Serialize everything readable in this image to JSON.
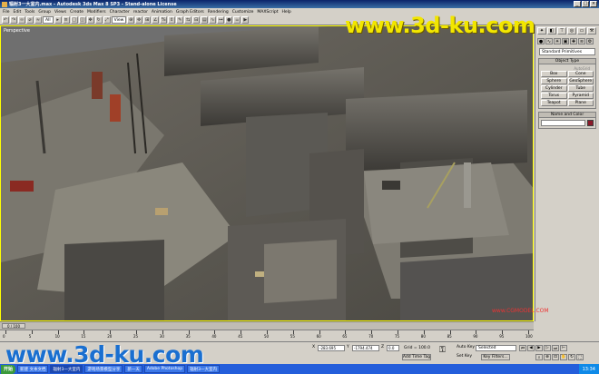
{
  "window": {
    "title": "辐射3一大室内.max - Autodesk 3ds Max 8 SP3 - Stand-alone License",
    "buttons": [
      "_",
      "□",
      "×"
    ]
  },
  "menu": {
    "items": [
      "File",
      "Edit",
      "Tools",
      "Group",
      "Views",
      "Create",
      "Modifiers",
      "Character",
      "reactor",
      "Animation",
      "Graph Editors",
      "Rendering",
      "Customize",
      "MAXScript",
      "Help"
    ]
  },
  "toolbar": {
    "filter": "All",
    "coord_system": "View"
  },
  "viewport": {
    "label": "Perspective"
  },
  "watermarks": {
    "top": "www.3d-ku.com",
    "bottom": "www.3d-ku.com",
    "small": "www.CGMODEL.COM"
  },
  "command_panel": {
    "category_dropdown": "Standard Primitives",
    "object_type_title": "Object Type",
    "autogrid_label": "AutoGrid",
    "objects": [
      "Box",
      "Cone",
      "Sphere",
      "GeoSphere",
      "Cylinder",
      "Tube",
      "Torus",
      "Pyramid",
      "Teapot",
      "Plane"
    ],
    "name_color_title": "Name and Color",
    "swatch_color": "#8b1a2a"
  },
  "timeslider": {
    "frame_display": "0 / 100"
  },
  "trackbar": {
    "ticks": [
      "0",
      "5",
      "10",
      "15",
      "20",
      "25",
      "30",
      "35",
      "40",
      "45",
      "50",
      "55",
      "60",
      "65",
      "70",
      "75",
      "80",
      "85",
      "90",
      "95",
      "100"
    ]
  },
  "status": {
    "x_label": "X",
    "x_value": "-283.695",
    "y_label": "Y",
    "y_value": "-1794.474",
    "z_label": "Z",
    "z_value": "0.0",
    "grid": "Grid = 100.0",
    "add_time_tag": "Add Time Tag",
    "auto_key": "Auto Key",
    "set_key": "Set Key",
    "selected": "Selected",
    "key_filters": "Key Filters..."
  },
  "taskbar": {
    "start": "开始",
    "tasks": [
      "新建 文本文档",
      "辐射3一大室内",
      "游戏场景模型分享",
      "新一天",
      "Adobe Photoshop",
      "辐射3一大室内"
    ],
    "clock": "13:34"
  }
}
